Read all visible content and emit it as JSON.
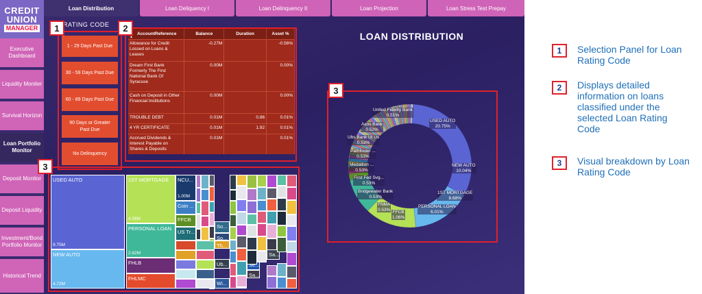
{
  "logo": {
    "line1": "CREDIT",
    "line2": "UNION",
    "line3": "MANAGER"
  },
  "sidebar": {
    "items": [
      {
        "label": "Executive Dashboard"
      },
      {
        "label": "Liquidity Moniter"
      },
      {
        "label": "Survival Horizon"
      },
      {
        "label": "Loan Portfolio Monitor"
      },
      {
        "label": "Deposit Monitor"
      },
      {
        "label": "Deposit Liquidity"
      },
      {
        "label": "Investment/Bond Portfolio Monitor"
      },
      {
        "label": "Historical Trend"
      }
    ]
  },
  "tabs": [
    {
      "label": "Loan Distribution"
    },
    {
      "label": "Loan Deliquency I"
    },
    {
      "label": "Loan Delinquency II"
    },
    {
      "label": "Loan Projection"
    },
    {
      "label": "Loan Stress Test Prepay"
    }
  ],
  "rating_panel": {
    "title": "RATING CODE",
    "options": [
      "1 - 29 Days Past Due",
      "30 - 59 Days Past Due",
      "60 - 89 Days Past Due",
      "90 Days or Greater Past Due",
      "No Delinquency"
    ]
  },
  "table": {
    "headers": [
      "AccountReference",
      "Balance",
      "Duration",
      "Asset %"
    ],
    "sort_indicator": "▲",
    "rows": [
      [
        "Allowance for Credit Lossed on Loans & Leases",
        "-0.27M",
        "",
        "-0.56%"
      ],
      [
        "Dream First Bank Formerly The First National Bank Of Syracuse",
        "0.00M",
        "",
        "0.00%"
      ],
      [
        "Cash on Deposit in Other Financial Institutions",
        "0.00M",
        "",
        "0.00%"
      ],
      [
        "TROUBLE DEBT",
        "0.01M",
        "0.86",
        "0.01%"
      ],
      [
        "4 YR CERTIFICATE",
        "0.01M",
        "1.92",
        "0.01%"
      ],
      [
        "Accrued Dividends & Interest Payable on Shares & Deposits",
        "0.01M",
        "",
        "0.01%"
      ]
    ]
  },
  "treemap": {
    "blocks": [
      {
        "name": "USED AUTO",
        "value": "9.75M",
        "color": "#5a64d2"
      },
      {
        "name": "NEW AUTO",
        "value": "4.72M",
        "color": "#67b8ee"
      },
      {
        "name": "1ST MORTGAGE",
        "value": "4.08M",
        "color": "#b5e156"
      },
      {
        "name": "PERSONAL LOAN",
        "value": "2.82M",
        "color": "#3fb89a"
      },
      {
        "name": "FHLB",
        "value": "",
        "color": "#6b2d74"
      },
      {
        "name": "FHLMC",
        "value": "",
        "color": "#e44a2c"
      },
      {
        "name": "NCU...",
        "value": "1.00M",
        "color": "#1a3a6e"
      },
      {
        "name": "Coin ...",
        "value": "",
        "color": "#3d7fc4"
      },
      {
        "name": "FFCB",
        "value": "",
        "color": "#5d8f24"
      },
      {
        "name": "US Tr...",
        "value": "",
        "color": "#1f6e78"
      },
      {
        "name": "So...",
        "value": "",
        "color": "#2f6a8a"
      },
      {
        "name": "So...",
        "value": "",
        "color": "#2b4a7a"
      },
      {
        "name": "Th...",
        "value": "",
        "color": "#e0a126"
      },
      {
        "name": "Ub...",
        "value": "",
        "color": "#34404e"
      },
      {
        "name": "Wi...",
        "value": "",
        "color": "#2c5a9c"
      },
      {
        "name": "Sa...",
        "value": "",
        "color": "#3a4550"
      },
      {
        "name": "Se...",
        "value": "",
        "color": "#1f58b0"
      },
      {
        "name": "Sa...",
        "value": "",
        "color": "#3f3a4a"
      }
    ]
  },
  "chart_title": "LOAN DISTRIBUTION",
  "chart_data": {
    "type": "pie",
    "title": "LOAN DISTRIBUTION",
    "slices": [
      {
        "label": "USED AUTO",
        "value": 20.75,
        "color": "#5a64d2"
      },
      {
        "label": "NEW AUTO",
        "value": 10.04,
        "color": "#67b8ee"
      },
      {
        "label": "1ST MORTGAGE",
        "value": 8.68,
        "color": "#b5e156"
      },
      {
        "label": "PERSONAL LOAN",
        "value": 6.01,
        "color": "#3fb89a"
      },
      {
        "label": "FFCB",
        "value": 1.06,
        "color": "#5d8f24"
      },
      {
        "label": "FNMA",
        "value": 0.53,
        "color": "#b3407a"
      },
      {
        "label": "Bridgewater Bank",
        "value": 0.53,
        "color": "#7a4a2a"
      },
      {
        "label": "First Fed Svg...",
        "value": 0.53,
        "color": "#4a8a6a"
      },
      {
        "label": "Medallion ...",
        "value": 0.53,
        "color": "#8a8a2a"
      },
      {
        "label": "Pathfinder ...",
        "value": 0.53,
        "color": "#2a6a9a"
      },
      {
        "label": "Ubs Bank Ut Us",
        "value": 0.53,
        "color": "#9a5a8a"
      },
      {
        "label": "Axos Bank",
        "value": 0.52,
        "color": "#6a9a3a"
      },
      {
        "label": "United Fidelity Bank",
        "value": 0.51,
        "color": "#c0a040"
      }
    ]
  },
  "legend": [
    {
      "num": "1",
      "text": "Selection Panel for Loan Rating Code"
    },
    {
      "num": "2",
      "text": "Displays detailed information on loans classified under the selected Loan Rating Code"
    },
    {
      "num": "3",
      "text": "Visual breakdown by Loan Rating Code"
    }
  ],
  "annotations": {
    "n1": "1",
    "n2": "2",
    "n3a": "3",
    "n3b": "3"
  }
}
